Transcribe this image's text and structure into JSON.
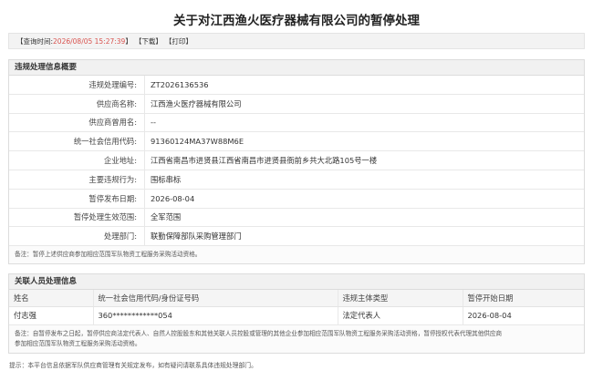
{
  "title": "关于对江西渔火医疗器械有限公司的暂停处理",
  "toolbar": {
    "query_label": "【查询时间:",
    "query_time": "2026/08/05 15:27:39",
    "query_close": "】",
    "download": "【下载】",
    "print": "【打印】"
  },
  "violation": {
    "header": "违规处理信息概要",
    "rows": [
      {
        "key": "违规处理编号:",
        "value": "ZT2026136536"
      },
      {
        "key": "供应商名称:",
        "value": "江西渔火医疗器械有限公司"
      },
      {
        "key": "供应商曾用名:",
        "value": "--"
      },
      {
        "key": "统一社会信用代码:",
        "value": "91360124MA37W88M6E"
      },
      {
        "key": "企业地址:",
        "value": "江西省南昌市进贤县江西省南昌市进贤县衙前乡共大北路105号一楼"
      },
      {
        "key": "主要违规行为:",
        "value": "围标串标"
      },
      {
        "key": "暂停发布日期:",
        "value": "2026-08-04"
      },
      {
        "key": "暂停处理生效范围:",
        "value": "全军范围"
      },
      {
        "key": "处理部门:",
        "value": "联勤保障部队采购管理部门"
      }
    ],
    "note": "备注：暂停上述供应商参加相应范围军队物资工程服务采购活动资格。"
  },
  "related": {
    "header": "关联人员处理信息",
    "columns": [
      "姓名",
      "统一社会信用代码/身份证号码",
      "违规主体类型",
      "暂停开始日期"
    ],
    "rows": [
      [
        "付志强",
        "360************054",
        "法定代表人",
        "2026-08-04"
      ]
    ],
    "note_line1": "备注：自暂停发布之日起，暂停供应商法定代表人、自然人控股股东和其他关联人员控股或管理的其他企业参加相应范围军队物资工程服务采购活动资格，暂停授权代表代理其他供应商",
    "note_line2": "参加相应范围军队物资工程服务采购活动资格。"
  },
  "footer": "提示：本平台信息依据军队供应商管理有关规定发布，如有疑问请联系具体违规处理部门。"
}
